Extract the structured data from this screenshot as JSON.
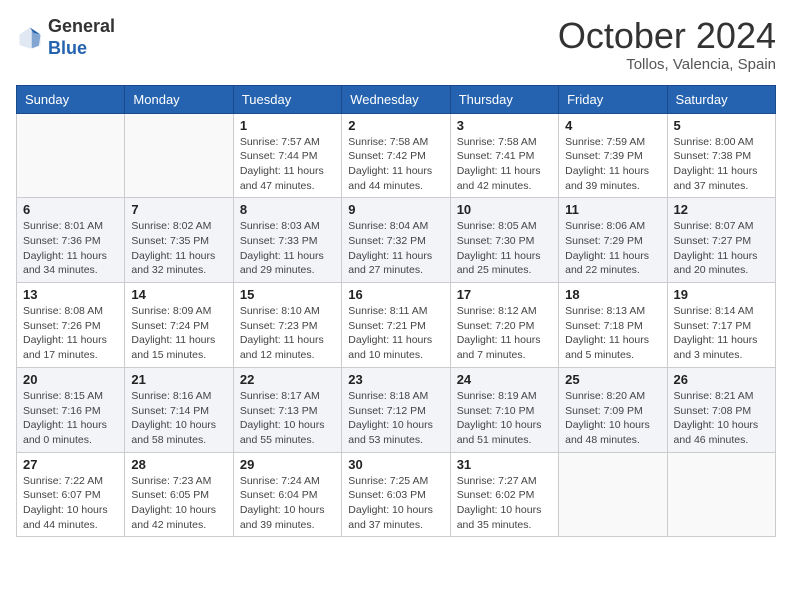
{
  "header": {
    "logo_general": "General",
    "logo_blue": "Blue",
    "month_year": "October 2024",
    "location": "Tollos, Valencia, Spain"
  },
  "days_of_week": [
    "Sunday",
    "Monday",
    "Tuesday",
    "Wednesday",
    "Thursday",
    "Friday",
    "Saturday"
  ],
  "weeks": [
    [
      {
        "day": "",
        "info": ""
      },
      {
        "day": "",
        "info": ""
      },
      {
        "day": "1",
        "info": "Sunrise: 7:57 AM\nSunset: 7:44 PM\nDaylight: 11 hours and 47 minutes."
      },
      {
        "day": "2",
        "info": "Sunrise: 7:58 AM\nSunset: 7:42 PM\nDaylight: 11 hours and 44 minutes."
      },
      {
        "day": "3",
        "info": "Sunrise: 7:58 AM\nSunset: 7:41 PM\nDaylight: 11 hours and 42 minutes."
      },
      {
        "day": "4",
        "info": "Sunrise: 7:59 AM\nSunset: 7:39 PM\nDaylight: 11 hours and 39 minutes."
      },
      {
        "day": "5",
        "info": "Sunrise: 8:00 AM\nSunset: 7:38 PM\nDaylight: 11 hours and 37 minutes."
      }
    ],
    [
      {
        "day": "6",
        "info": "Sunrise: 8:01 AM\nSunset: 7:36 PM\nDaylight: 11 hours and 34 minutes."
      },
      {
        "day": "7",
        "info": "Sunrise: 8:02 AM\nSunset: 7:35 PM\nDaylight: 11 hours and 32 minutes."
      },
      {
        "day": "8",
        "info": "Sunrise: 8:03 AM\nSunset: 7:33 PM\nDaylight: 11 hours and 29 minutes."
      },
      {
        "day": "9",
        "info": "Sunrise: 8:04 AM\nSunset: 7:32 PM\nDaylight: 11 hours and 27 minutes."
      },
      {
        "day": "10",
        "info": "Sunrise: 8:05 AM\nSunset: 7:30 PM\nDaylight: 11 hours and 25 minutes."
      },
      {
        "day": "11",
        "info": "Sunrise: 8:06 AM\nSunset: 7:29 PM\nDaylight: 11 hours and 22 minutes."
      },
      {
        "day": "12",
        "info": "Sunrise: 8:07 AM\nSunset: 7:27 PM\nDaylight: 11 hours and 20 minutes."
      }
    ],
    [
      {
        "day": "13",
        "info": "Sunrise: 8:08 AM\nSunset: 7:26 PM\nDaylight: 11 hours and 17 minutes."
      },
      {
        "day": "14",
        "info": "Sunrise: 8:09 AM\nSunset: 7:24 PM\nDaylight: 11 hours and 15 minutes."
      },
      {
        "day": "15",
        "info": "Sunrise: 8:10 AM\nSunset: 7:23 PM\nDaylight: 11 hours and 12 minutes."
      },
      {
        "day": "16",
        "info": "Sunrise: 8:11 AM\nSunset: 7:21 PM\nDaylight: 11 hours and 10 minutes."
      },
      {
        "day": "17",
        "info": "Sunrise: 8:12 AM\nSunset: 7:20 PM\nDaylight: 11 hours and 7 minutes."
      },
      {
        "day": "18",
        "info": "Sunrise: 8:13 AM\nSunset: 7:18 PM\nDaylight: 11 hours and 5 minutes."
      },
      {
        "day": "19",
        "info": "Sunrise: 8:14 AM\nSunset: 7:17 PM\nDaylight: 11 hours and 3 minutes."
      }
    ],
    [
      {
        "day": "20",
        "info": "Sunrise: 8:15 AM\nSunset: 7:16 PM\nDaylight: 11 hours and 0 minutes."
      },
      {
        "day": "21",
        "info": "Sunrise: 8:16 AM\nSunset: 7:14 PM\nDaylight: 10 hours and 58 minutes."
      },
      {
        "day": "22",
        "info": "Sunrise: 8:17 AM\nSunset: 7:13 PM\nDaylight: 10 hours and 55 minutes."
      },
      {
        "day": "23",
        "info": "Sunrise: 8:18 AM\nSunset: 7:12 PM\nDaylight: 10 hours and 53 minutes."
      },
      {
        "day": "24",
        "info": "Sunrise: 8:19 AM\nSunset: 7:10 PM\nDaylight: 10 hours and 51 minutes."
      },
      {
        "day": "25",
        "info": "Sunrise: 8:20 AM\nSunset: 7:09 PM\nDaylight: 10 hours and 48 minutes."
      },
      {
        "day": "26",
        "info": "Sunrise: 8:21 AM\nSunset: 7:08 PM\nDaylight: 10 hours and 46 minutes."
      }
    ],
    [
      {
        "day": "27",
        "info": "Sunrise: 7:22 AM\nSunset: 6:07 PM\nDaylight: 10 hours and 44 minutes."
      },
      {
        "day": "28",
        "info": "Sunrise: 7:23 AM\nSunset: 6:05 PM\nDaylight: 10 hours and 42 minutes."
      },
      {
        "day": "29",
        "info": "Sunrise: 7:24 AM\nSunset: 6:04 PM\nDaylight: 10 hours and 39 minutes."
      },
      {
        "day": "30",
        "info": "Sunrise: 7:25 AM\nSunset: 6:03 PM\nDaylight: 10 hours and 37 minutes."
      },
      {
        "day": "31",
        "info": "Sunrise: 7:27 AM\nSunset: 6:02 PM\nDaylight: 10 hours and 35 minutes."
      },
      {
        "day": "",
        "info": ""
      },
      {
        "day": "",
        "info": ""
      }
    ]
  ]
}
